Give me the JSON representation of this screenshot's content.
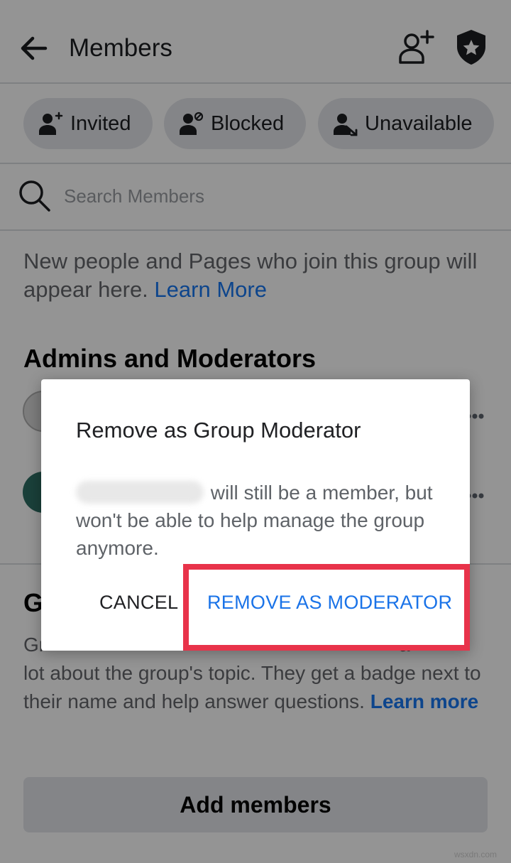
{
  "header": {
    "title": "Members",
    "back_icon": "arrow-left-icon",
    "add_icon": "add-person-icon",
    "shield_icon": "shield-star-icon"
  },
  "chips": [
    {
      "label": "Invited",
      "icon": "person-plus-icon"
    },
    {
      "label": "Blocked",
      "icon": "person-blocked-icon"
    },
    {
      "label": "Unavailable",
      "icon": "person-unavailable-icon"
    }
  ],
  "search": {
    "placeholder": "Search Members"
  },
  "info": {
    "text": "New people and Pages who join this group will appear here. ",
    "link": "Learn More"
  },
  "admins": {
    "heading": "Admins and Moderators"
  },
  "experts": {
    "heading_initial": "G",
    "text_line1": "Gr                                                                a",
    "text": "lot about the group's topic. They get a badge next to their name and help answer questions. ",
    "link": "Learn more"
  },
  "add_members": {
    "label": "Add members"
  },
  "dialog": {
    "title": "Remove as Group Moderator",
    "body": "will still be a member, but won't be able to help manage the group anymore.",
    "cancel_label": "CANCEL",
    "confirm_label": "REMOVE AS MODERATOR"
  },
  "watermark": "wsxdn.com",
  "colors": {
    "link": "#1877f2",
    "dialog_action": "#1a73e8",
    "highlight": "#e8334a"
  }
}
